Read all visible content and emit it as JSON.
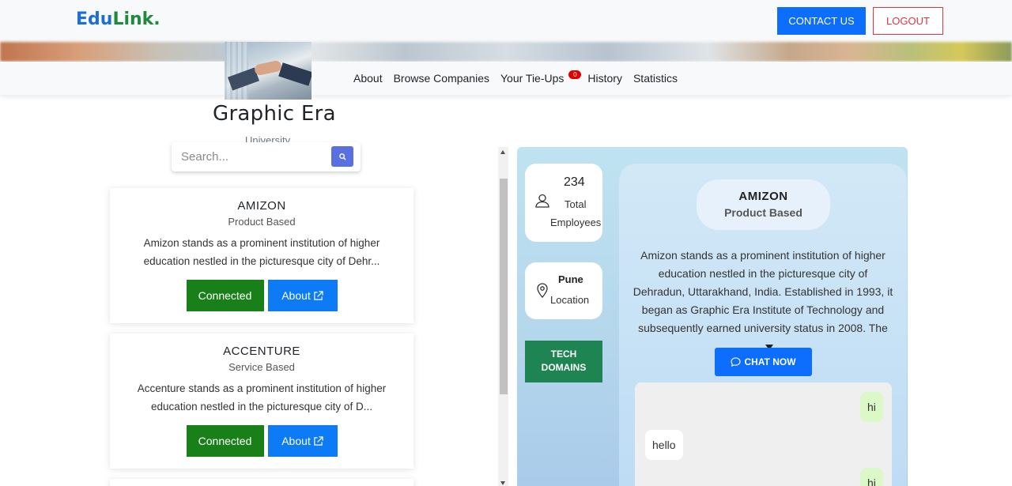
{
  "header": {
    "brand_part1": "Edu",
    "brand_part2": "Link.",
    "contact_label": "CONTACT US",
    "logout_label": "LOGOUT"
  },
  "nav": {
    "items": [
      "About",
      "Browse Companies",
      "Your Tie-Ups",
      "History",
      "Statistics"
    ],
    "tieups_badge": "0"
  },
  "profile": {
    "name": "Graphic Era",
    "type": "University"
  },
  "search": {
    "placeholder": "Search..."
  },
  "companies": [
    {
      "name": "AMIZON",
      "type": "Product Based",
      "desc": "Amizon stands as a prominent institution of higher education nestled in the picturesque city of Dehr...",
      "status_label": "Connected",
      "about_label": "About"
    },
    {
      "name": "ACCENTURE",
      "type": "Service Based",
      "desc": "Accenture stands as a prominent institution of higher education nestled in the picturesque city of D...",
      "status_label": "Connected",
      "about_label": "About"
    }
  ],
  "detail": {
    "employees_count": "234",
    "employees_label1": "Total",
    "employees_label2": "Employees",
    "location_city": "Pune",
    "location_label": "Location",
    "tech_label1": "TECH",
    "tech_label2": "DOMAINS",
    "company_name": "AMIZON",
    "company_type": "Product Based",
    "description": "Amizon stands as a prominent institution of higher education nestled in the picturesque city of Dehradun, Uttarakhand, India. Established in 1993, it began as Graphic Era Institute of Technology and subsequently earned university status in 2008. The ...",
    "chat_label": "CHAT NOW"
  },
  "chat": {
    "messages": [
      {
        "from": "me",
        "text": "hi"
      },
      {
        "from": "them",
        "text": "hello"
      },
      {
        "from": "me",
        "text": "hi"
      }
    ]
  },
  "colors": {
    "brand_blue": "#1a6fd8",
    "brand_green": "#1e8a3e",
    "primary": "#0d6efd",
    "connected": "#198019",
    "logout": "#dc3545"
  }
}
